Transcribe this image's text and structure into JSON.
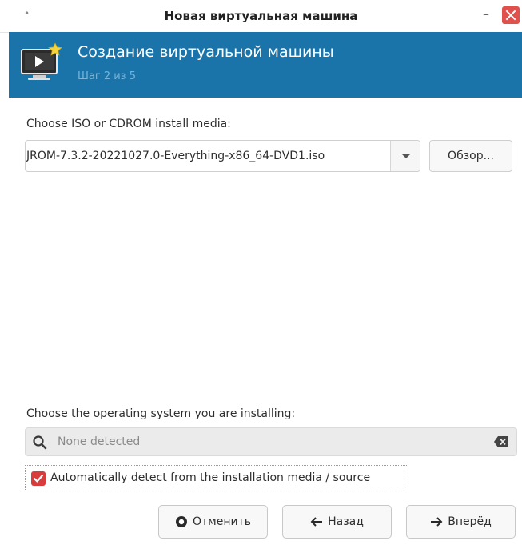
{
  "window": {
    "title": "Новая виртуальная машина",
    "menu_glyph": "•",
    "minimize_glyph": "–"
  },
  "header": {
    "title": "Создание виртуальной машины",
    "step": "Шаг 2 из 5"
  },
  "install_media": {
    "label": "Choose ISO or CDROM install media:",
    "value": "JROM-7.3.2-20221027.0-Everything-x86_64-DVD1.iso",
    "browse_label": "Обзор..."
  },
  "os_select": {
    "label": "Choose the operating system you are installing:",
    "placeholder": "None detected",
    "auto_detect_label": "Automatically detect from the installation media / source",
    "auto_detect_checked": true
  },
  "buttons": {
    "cancel_label": "Отменить",
    "back_label": "Назад",
    "forward_label": "Вперёд"
  },
  "colors": {
    "header_bg": "#1a73a9",
    "close_button": "#e0504d",
    "checkbox": "#d83c3c"
  }
}
